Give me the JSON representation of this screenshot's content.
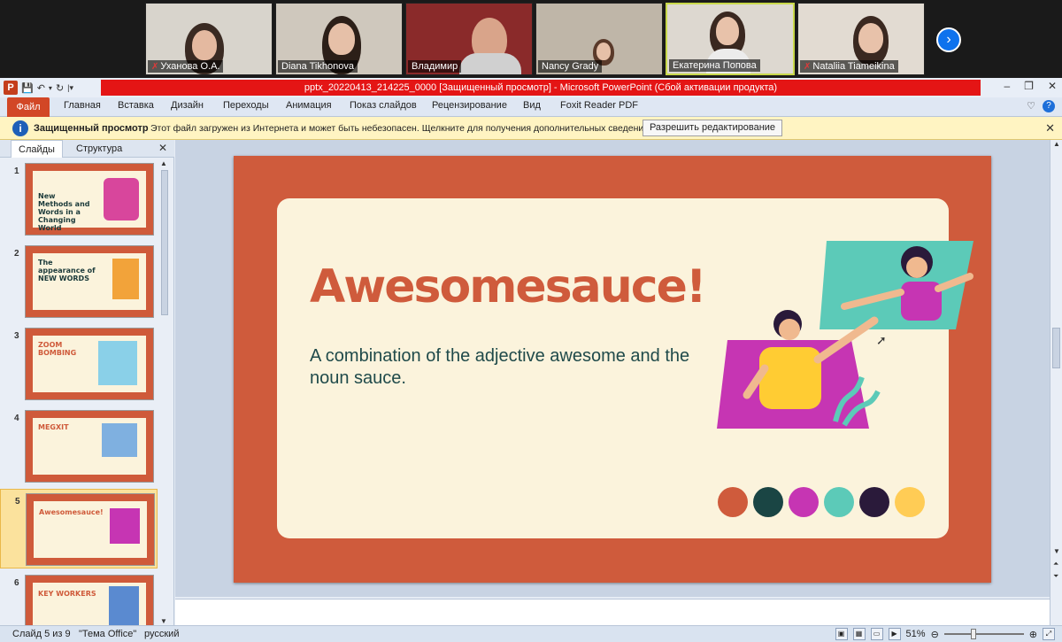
{
  "participants": [
    {
      "name": "Уханова О.А.",
      "muted": true
    },
    {
      "name": "Diana Tikhonova",
      "muted": false
    },
    {
      "name": "Владимир",
      "muted": false
    },
    {
      "name": "Nancy Grady",
      "muted": false
    },
    {
      "name": "Екатерина Попова",
      "muted": false
    },
    {
      "name": "Nataliia Tiameikina",
      "muted": true
    }
  ],
  "window": {
    "title": "pptx_20220413_214225_0000 [Защищенный просмотр] - Microsoft PowerPoint (Сбой активации продукта)"
  },
  "ribbon": {
    "tabs": [
      "Файл",
      "Главная",
      "Вставка",
      "Дизайн",
      "Переходы",
      "Анимация",
      "Показ слайдов",
      "Рецензирование",
      "Вид",
      "Foxit Reader PDF"
    ]
  },
  "protected_view": {
    "title": "Защищенный просмотр",
    "message": "Этот файл загружен из Интернета и может быть небезопасен. Щелкните для получения дополнительных сведений.",
    "button": "Разрешить редактирование"
  },
  "pane": {
    "tab_slides": "Слайды",
    "tab_outline": "Структура"
  },
  "thumbnails": [
    {
      "num": "1",
      "title": "New Methods and Words in a Changing World"
    },
    {
      "num": "2",
      "title": "The appearance of NEW WORDS"
    },
    {
      "num": "3",
      "title": "ZOOM BOMBING"
    },
    {
      "num": "4",
      "title": "MEGXIT"
    },
    {
      "num": "5",
      "title": "Awesomesauce!"
    },
    {
      "num": "6",
      "title": "KEY WORKERS"
    }
  ],
  "slide": {
    "title": "Awesomesauce!",
    "body": "A combination of the adjective awesome and the noun sauce.",
    "colors": [
      "#cf5b3c",
      "#1a4544",
      "#c635b3",
      "#5ccab8",
      "#2a1a3a",
      "#ffcc55"
    ]
  },
  "status": {
    "slide_counter": "Слайд 5 из 9",
    "theme": "\"Тема Office\"",
    "language": "русский",
    "zoom": "51%"
  }
}
